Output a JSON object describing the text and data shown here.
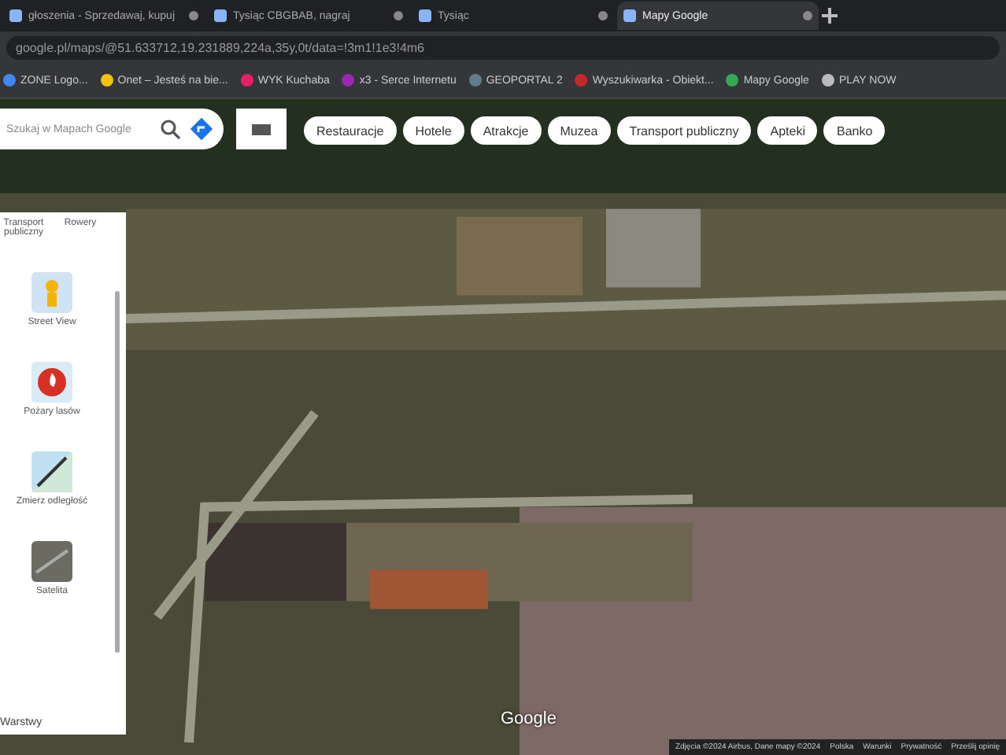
{
  "tabs": [
    {
      "label": "głoszenia - Sprzedawaj, kupuj",
      "selected": false
    },
    {
      "label": "Tysiąc CBGBAB, nagraj",
      "selected": false
    },
    {
      "label": "Tysiąc",
      "selected": false
    },
    {
      "label": "Mapy Google",
      "selected": true
    }
  ],
  "address_bar": {
    "url": "google.pl/maps/@51.633712,19.231889,224a,35y,0t/data=!3m1!1e3!4m6"
  },
  "bookmarks": [
    {
      "label": "ZONE Logo...",
      "color": "#4285f4"
    },
    {
      "label": "Onet – Jesteś na bie...",
      "color": "#f4c20d"
    },
    {
      "label": "WYK Kuchaba",
      "color": "#e91e63"
    },
    {
      "label": "x3 - Serce Internetu",
      "color": "#9c27b0"
    },
    {
      "label": "GEOPORTAL 2",
      "color": "#607d8b"
    },
    {
      "label": "Wyszukiwarka - Obiekt...",
      "color": "#c62828"
    },
    {
      "label": "Mapy Google",
      "color": "#34a853"
    },
    {
      "label": "PLAY NOW",
      "color": "#bbbbbb"
    }
  ],
  "search": {
    "placeholder": "Szukaj w Mapach Google"
  },
  "chips": [
    "Restauracje",
    "Hotele",
    "Atrakcje",
    "Muzea",
    "Transport publiczny",
    "Apteki",
    "Banko"
  ],
  "layers_panel": {
    "top_labels": [
      "Transport publiczny",
      "Rowery"
    ],
    "items": [
      {
        "label": "Street View",
        "kind": "streetview"
      },
      {
        "label": "Pożary lasów",
        "kind": "fire"
      },
      {
        "label": "Zmierz odległość",
        "kind": "measure"
      },
      {
        "label": "Satelita",
        "kind": "satellite"
      }
    ],
    "footer": "Warstwy"
  },
  "map": {
    "logo": "Google",
    "footer": [
      "Zdjęcia ©2024 Airbus, Dane mapy ©2024",
      "Polska",
      "Warunki",
      "Prywatność",
      "Prześlij opinię"
    ]
  }
}
